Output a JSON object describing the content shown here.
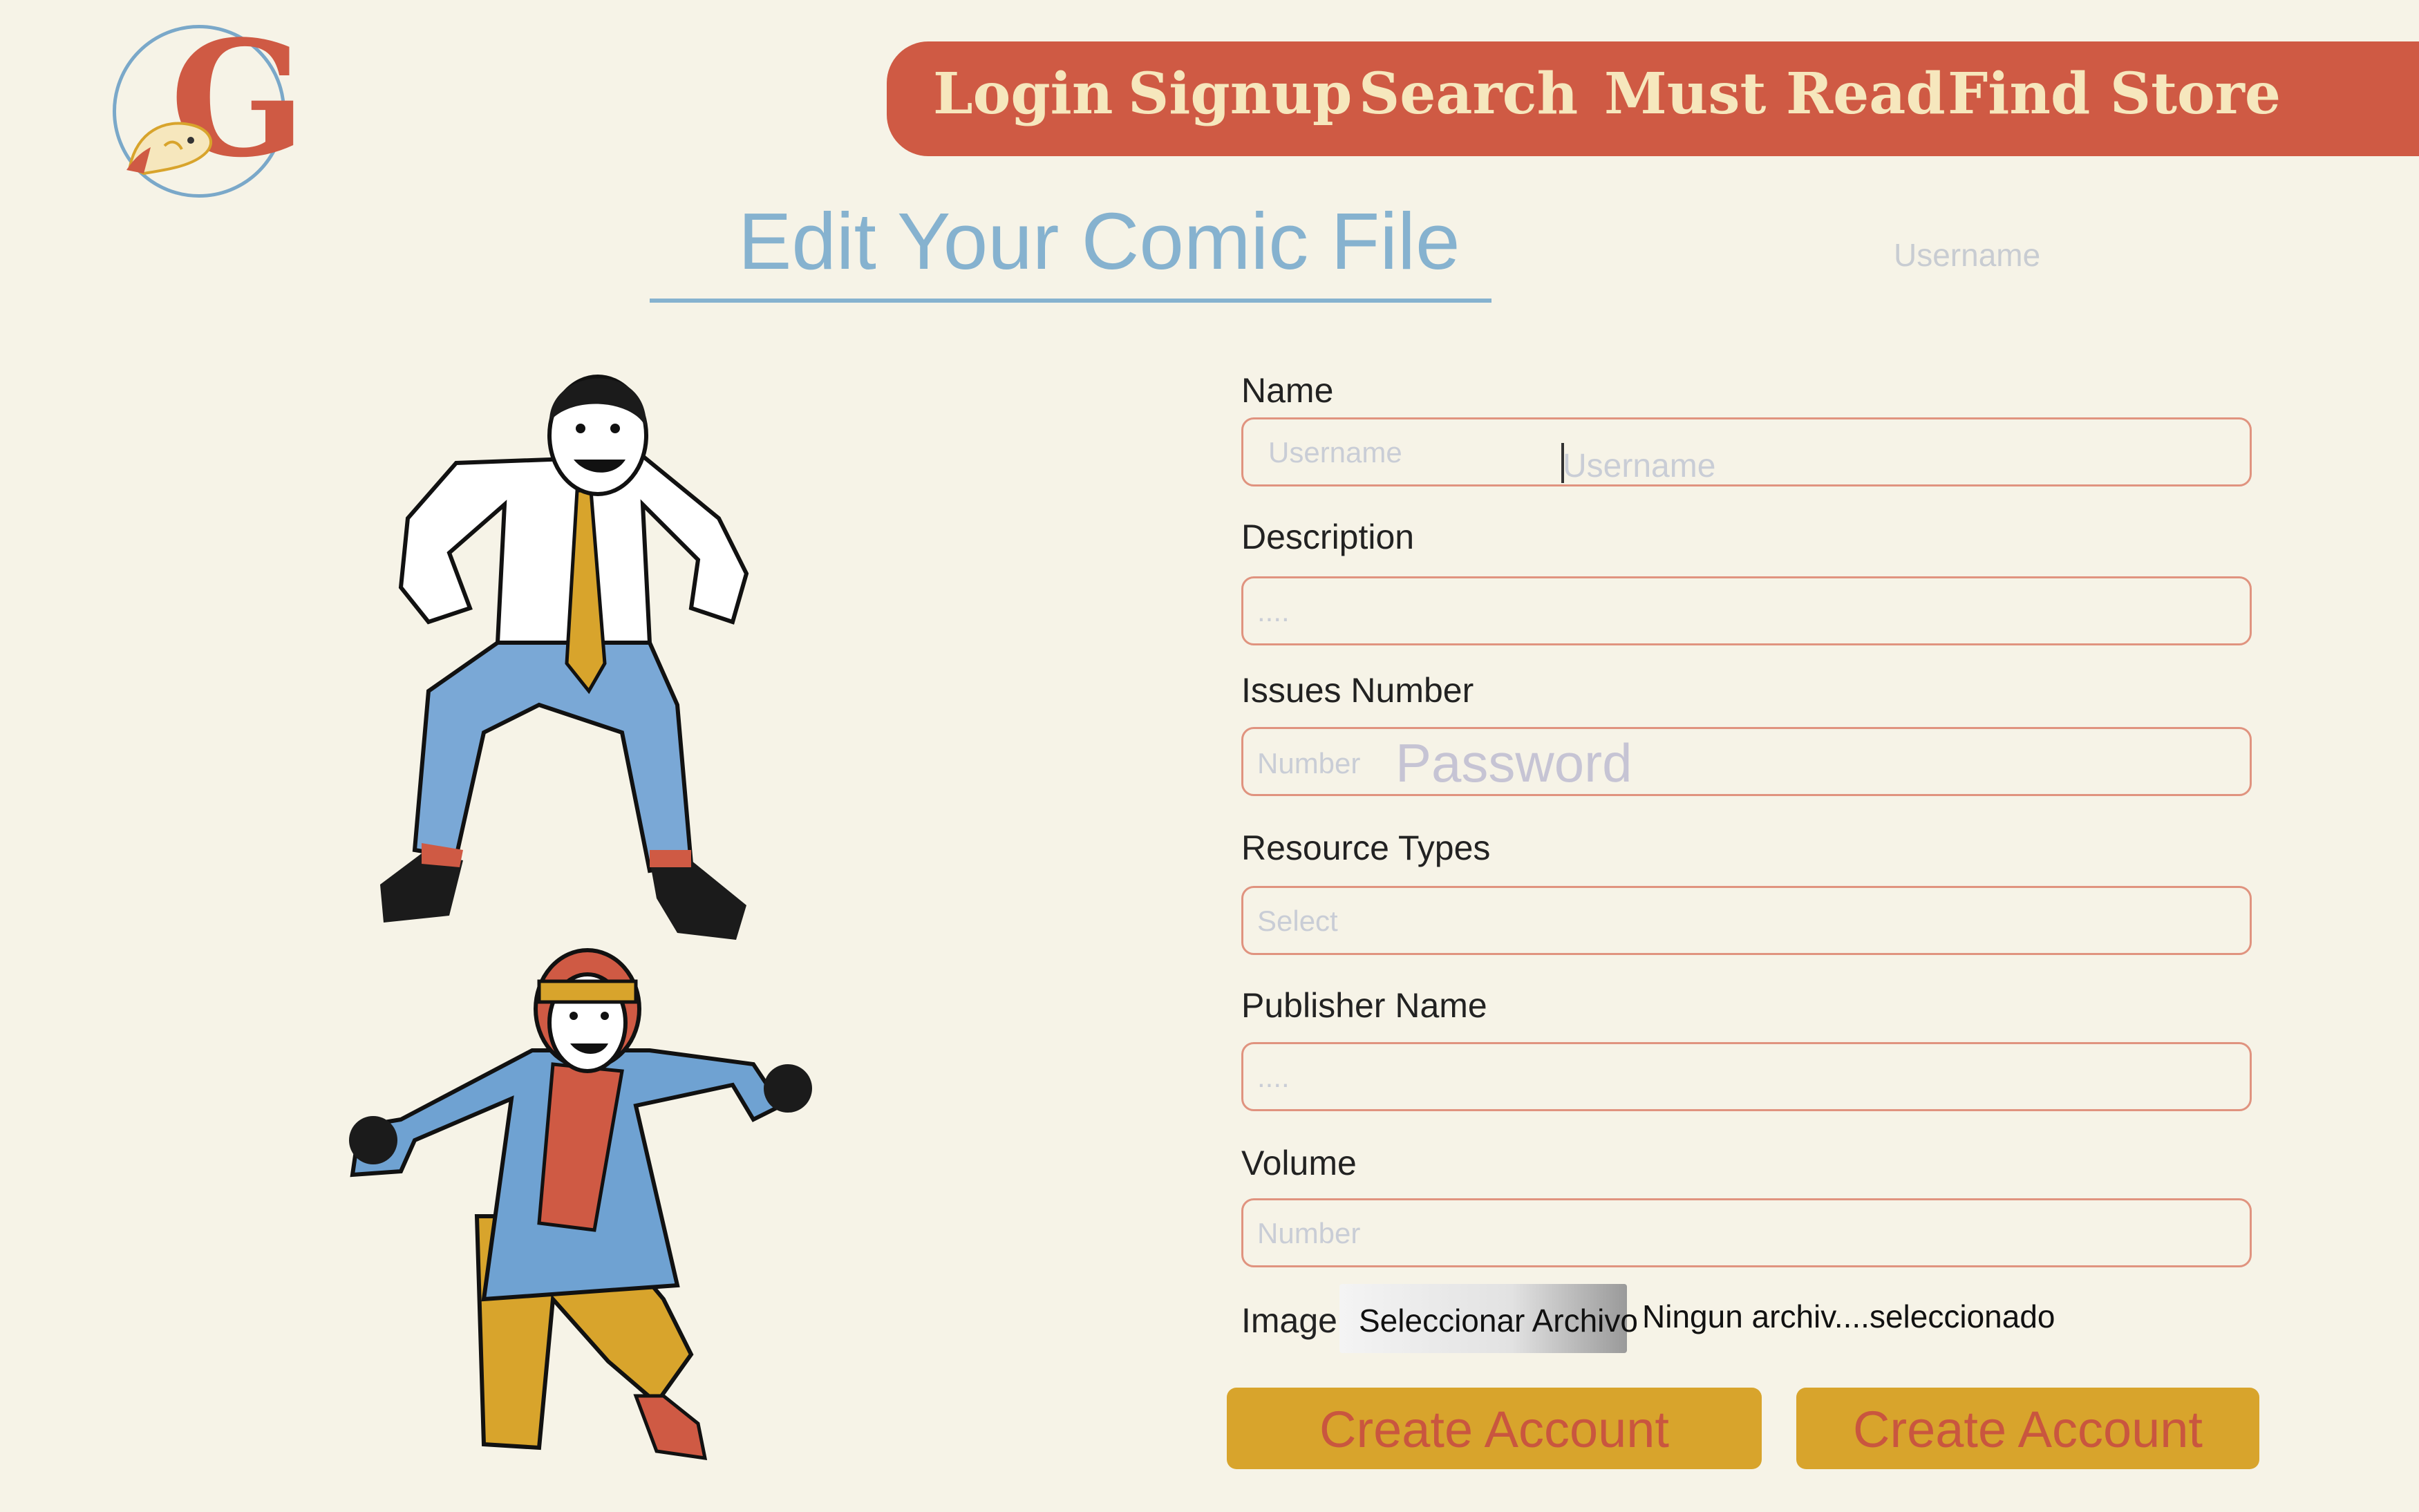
{
  "logo": {
    "letter": "G",
    "icon": "comic-logo-icon"
  },
  "nav": {
    "items": [
      "Login",
      "Signup",
      "Search",
      "Must Read",
      "Find Store"
    ]
  },
  "page_title": "Edit Your Comic File",
  "ghost_username": "Username",
  "form": {
    "name": {
      "label": "Name",
      "placeholder": "Username",
      "overlay": "Username"
    },
    "description": {
      "label": "Description",
      "placeholder": "...."
    },
    "issues": {
      "label": "Issues Number",
      "placeholder": "Number",
      "overlay": "Password"
    },
    "resource_types": {
      "label": "Resource Types",
      "placeholder": "Select"
    },
    "publisher": {
      "label": "Publisher Name",
      "placeholder": "...."
    },
    "volume": {
      "label": "Volume",
      "placeholder": "Number"
    },
    "image": {
      "label": "Image:",
      "button": "Seleccionar Archivo",
      "status": "Ningun archiv....seleccionado"
    }
  },
  "buttons": {
    "left": "Create Account",
    "right": "Create Account"
  },
  "colors": {
    "brand": "#cf5a44",
    "accent": "#86b2cf",
    "button": "#d8a42c",
    "background": "#f6f3e7"
  }
}
